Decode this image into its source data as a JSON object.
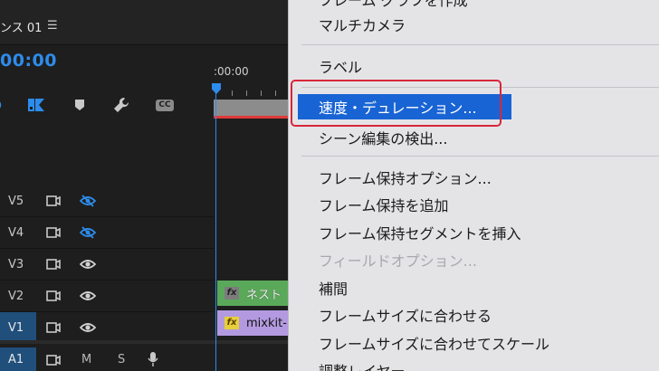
{
  "timeline": {
    "sequence_name": "ンス 01",
    "menu_glyph": "☰",
    "timecode": "00:00",
    "ruler_time": ":00:00",
    "tracks": [
      {
        "id": "V5",
        "label": "V5"
      },
      {
        "id": "V4",
        "label": "V4"
      },
      {
        "id": "V3",
        "label": "V3"
      },
      {
        "id": "V2",
        "label": "V2"
      },
      {
        "id": "V1",
        "label": "V1"
      },
      {
        "id": "A1",
        "label": "A1",
        "mute": "M",
        "solo": "S"
      }
    ],
    "clips": {
      "nest": {
        "label": "ネスト",
        "fx": "fx"
      },
      "mixkit": {
        "label": "mixkit-",
        "fx": "fx"
      }
    },
    "cc_label": "CC",
    "colors": {
      "accent": "#2d8ceb",
      "v_clip": "#5aa95a",
      "a_clip": "#b39ae0",
      "fx_badge": "#e7cf3a"
    }
  },
  "context_menu": {
    "top_partial": "フレーム グラフを作成",
    "items": {
      "multicam": "マルチカメラ",
      "label": "ラベル",
      "speed_duration": "速度・デュレーション...",
      "scene_detect": "シーン編集の検出...",
      "frame_hold_options": "フレーム保持オプション...",
      "add_frame_hold": "フレーム保持を追加",
      "insert_frame_hold_segment": "フレーム保持セグメントを挿入",
      "field_options": "フィールドオプション...",
      "interpolation": "補間",
      "scale_to_frame_size": "フレームサイズに合わせる",
      "set_to_frame_size": "フレームサイズに合わせてスケール",
      "adjustment_layer": "調整レイヤー"
    },
    "colors": {
      "highlight": "#1964d4",
      "focus_ring": "#d8263a",
      "background": "#e4e4e7"
    }
  }
}
